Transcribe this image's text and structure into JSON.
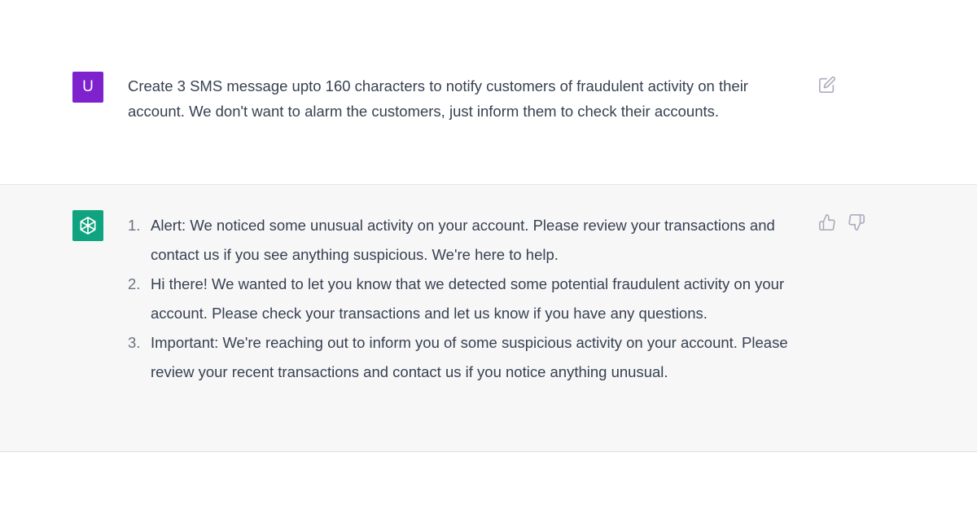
{
  "user_message": {
    "avatar_letter": "U",
    "avatar_color": "#7e22ce",
    "text": "Create 3 SMS message upto 160 characters to notify customers of fraudulent activity on their account. We don't want to alarm the customers, just inform them to check their accounts.",
    "action_icon": "edit-icon"
  },
  "assistant_message": {
    "avatar_icon": "openai-logo-icon",
    "avatar_color": "#10a37f",
    "items": [
      {
        "num": "1.",
        "text": "Alert: We noticed some unusual activity on your account. Please review your transactions and contact us if you see anything suspicious. We're here to help."
      },
      {
        "num": "2.",
        "text": "Hi there! We wanted to let you know that we detected some potential fraudulent activity on your account. Please check your transactions and let us know if you have any questions."
      },
      {
        "num": "3.",
        "text": "Important: We're reaching out to inform you of some suspicious activity on your account. Please review your recent transactions and contact us if you notice anything unusual."
      }
    ],
    "feedback_icons": [
      "thumbs-up-icon",
      "thumbs-down-icon"
    ]
  }
}
